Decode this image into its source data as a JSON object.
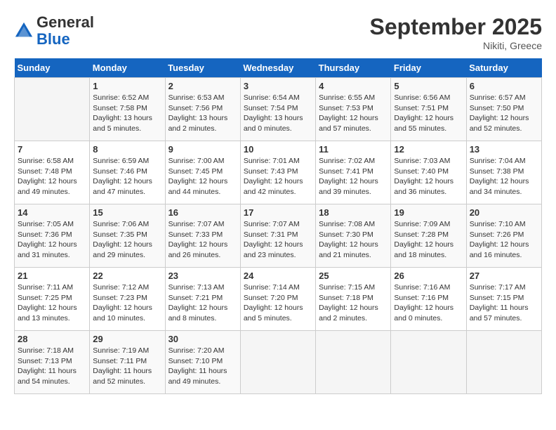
{
  "header": {
    "logo_general": "General",
    "logo_blue": "Blue",
    "month": "September 2025",
    "location": "Nikiti, Greece"
  },
  "days_of_week": [
    "Sunday",
    "Monday",
    "Tuesday",
    "Wednesday",
    "Thursday",
    "Friday",
    "Saturday"
  ],
  "weeks": [
    [
      {
        "day": "",
        "info": ""
      },
      {
        "day": "1",
        "info": "Sunrise: 6:52 AM\nSunset: 7:58 PM\nDaylight: 13 hours\nand 5 minutes."
      },
      {
        "day": "2",
        "info": "Sunrise: 6:53 AM\nSunset: 7:56 PM\nDaylight: 13 hours\nand 2 minutes."
      },
      {
        "day": "3",
        "info": "Sunrise: 6:54 AM\nSunset: 7:54 PM\nDaylight: 13 hours\nand 0 minutes."
      },
      {
        "day": "4",
        "info": "Sunrise: 6:55 AM\nSunset: 7:53 PM\nDaylight: 12 hours\nand 57 minutes."
      },
      {
        "day": "5",
        "info": "Sunrise: 6:56 AM\nSunset: 7:51 PM\nDaylight: 12 hours\nand 55 minutes."
      },
      {
        "day": "6",
        "info": "Sunrise: 6:57 AM\nSunset: 7:50 PM\nDaylight: 12 hours\nand 52 minutes."
      }
    ],
    [
      {
        "day": "7",
        "info": "Sunrise: 6:58 AM\nSunset: 7:48 PM\nDaylight: 12 hours\nand 49 minutes."
      },
      {
        "day": "8",
        "info": "Sunrise: 6:59 AM\nSunset: 7:46 PM\nDaylight: 12 hours\nand 47 minutes."
      },
      {
        "day": "9",
        "info": "Sunrise: 7:00 AM\nSunset: 7:45 PM\nDaylight: 12 hours\nand 44 minutes."
      },
      {
        "day": "10",
        "info": "Sunrise: 7:01 AM\nSunset: 7:43 PM\nDaylight: 12 hours\nand 42 minutes."
      },
      {
        "day": "11",
        "info": "Sunrise: 7:02 AM\nSunset: 7:41 PM\nDaylight: 12 hours\nand 39 minutes."
      },
      {
        "day": "12",
        "info": "Sunrise: 7:03 AM\nSunset: 7:40 PM\nDaylight: 12 hours\nand 36 minutes."
      },
      {
        "day": "13",
        "info": "Sunrise: 7:04 AM\nSunset: 7:38 PM\nDaylight: 12 hours\nand 34 minutes."
      }
    ],
    [
      {
        "day": "14",
        "info": "Sunrise: 7:05 AM\nSunset: 7:36 PM\nDaylight: 12 hours\nand 31 minutes."
      },
      {
        "day": "15",
        "info": "Sunrise: 7:06 AM\nSunset: 7:35 PM\nDaylight: 12 hours\nand 29 minutes."
      },
      {
        "day": "16",
        "info": "Sunrise: 7:07 AM\nSunset: 7:33 PM\nDaylight: 12 hours\nand 26 minutes."
      },
      {
        "day": "17",
        "info": "Sunrise: 7:07 AM\nSunset: 7:31 PM\nDaylight: 12 hours\nand 23 minutes."
      },
      {
        "day": "18",
        "info": "Sunrise: 7:08 AM\nSunset: 7:30 PM\nDaylight: 12 hours\nand 21 minutes."
      },
      {
        "day": "19",
        "info": "Sunrise: 7:09 AM\nSunset: 7:28 PM\nDaylight: 12 hours\nand 18 minutes."
      },
      {
        "day": "20",
        "info": "Sunrise: 7:10 AM\nSunset: 7:26 PM\nDaylight: 12 hours\nand 16 minutes."
      }
    ],
    [
      {
        "day": "21",
        "info": "Sunrise: 7:11 AM\nSunset: 7:25 PM\nDaylight: 12 hours\nand 13 minutes."
      },
      {
        "day": "22",
        "info": "Sunrise: 7:12 AM\nSunset: 7:23 PM\nDaylight: 12 hours\nand 10 minutes."
      },
      {
        "day": "23",
        "info": "Sunrise: 7:13 AM\nSunset: 7:21 PM\nDaylight: 12 hours\nand 8 minutes."
      },
      {
        "day": "24",
        "info": "Sunrise: 7:14 AM\nSunset: 7:20 PM\nDaylight: 12 hours\nand 5 minutes."
      },
      {
        "day": "25",
        "info": "Sunrise: 7:15 AM\nSunset: 7:18 PM\nDaylight: 12 hours\nand 2 minutes."
      },
      {
        "day": "26",
        "info": "Sunrise: 7:16 AM\nSunset: 7:16 PM\nDaylight: 12 hours\nand 0 minutes."
      },
      {
        "day": "27",
        "info": "Sunrise: 7:17 AM\nSunset: 7:15 PM\nDaylight: 11 hours\nand 57 minutes."
      }
    ],
    [
      {
        "day": "28",
        "info": "Sunrise: 7:18 AM\nSunset: 7:13 PM\nDaylight: 11 hours\nand 54 minutes."
      },
      {
        "day": "29",
        "info": "Sunrise: 7:19 AM\nSunset: 7:11 PM\nDaylight: 11 hours\nand 52 minutes."
      },
      {
        "day": "30",
        "info": "Sunrise: 7:20 AM\nSunset: 7:10 PM\nDaylight: 11 hours\nand 49 minutes."
      },
      {
        "day": "",
        "info": ""
      },
      {
        "day": "",
        "info": ""
      },
      {
        "day": "",
        "info": ""
      },
      {
        "day": "",
        "info": ""
      }
    ]
  ]
}
